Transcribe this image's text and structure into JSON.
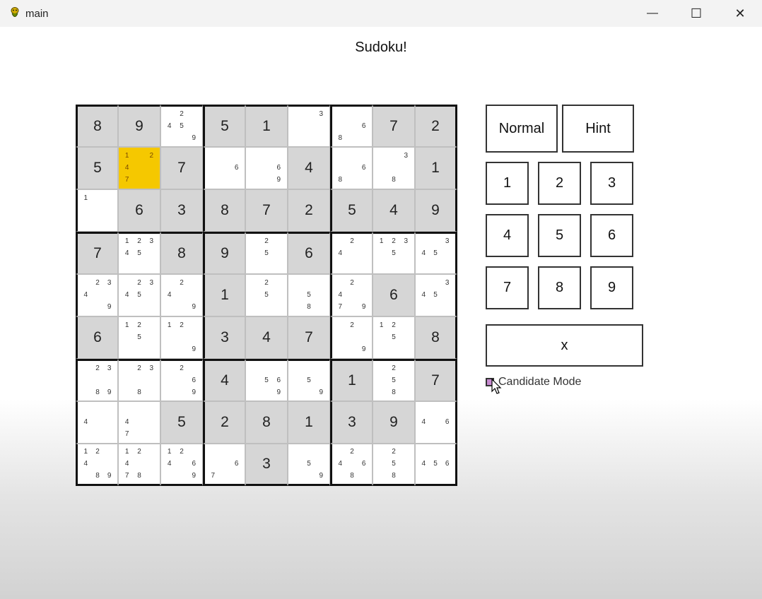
{
  "window": {
    "title": "main",
    "icon": "python-snake-icon",
    "controls": {
      "minimize": "—",
      "maximize": "☐",
      "close": "✕"
    }
  },
  "heading": "Sudoku!",
  "board": {
    "selected": [
      1,
      1
    ],
    "cells": [
      [
        {
          "v": "8"
        },
        {
          "v": "9"
        },
        {
          "c": [
            "",
            "2",
            "",
            "4",
            "5",
            "",
            "",
            "",
            "9"
          ]
        },
        {
          "v": "5"
        },
        {
          "v": "1"
        },
        {
          "c": [
            "",
            "",
            "3",
            "",
            "",
            "",
            "",
            "",
            ""
          ]
        },
        {
          "c": [
            "",
            "",
            "",
            "",
            "",
            "6",
            "8",
            "",
            ""
          ]
        },
        {
          "v": "7"
        },
        {
          "v": "2"
        }
      ],
      [
        {
          "v": "5"
        },
        {
          "c": [
            "1",
            "",
            "2",
            "4",
            "",
            "",
            "7",
            "",
            ""
          ]
        },
        {
          "v": "7"
        },
        {
          "c": [
            "",
            "",
            "",
            "",
            "",
            "6",
            "",
            "",
            ""
          ]
        },
        {
          "c": [
            "",
            "",
            "",
            "",
            "",
            "6",
            "",
            "",
            "9"
          ]
        },
        {
          "v": "4"
        },
        {
          "c": [
            "",
            "",
            "",
            "",
            "",
            "6",
            "8",
            "",
            ""
          ]
        },
        {
          "c": [
            "",
            "",
            "3",
            "",
            "",
            "",
            "",
            "8",
            ""
          ]
        },
        {
          "v": "1"
        }
      ],
      [
        {
          "c": [
            "1",
            "",
            "",
            "",
            "",
            "",
            "",
            "",
            ""
          ]
        },
        {
          "v": "6"
        },
        {
          "v": "3"
        },
        {
          "v": "8"
        },
        {
          "v": "7"
        },
        {
          "v": "2"
        },
        {
          "v": "5"
        },
        {
          "v": "4"
        },
        {
          "v": "9"
        }
      ],
      [
        {
          "v": "7"
        },
        {
          "c": [
            "1",
            "2",
            "3",
            "4",
            "5",
            "",
            "",
            "",
            ""
          ]
        },
        {
          "v": "8"
        },
        {
          "v": "9"
        },
        {
          "c": [
            "",
            "2",
            "",
            "",
            "5",
            "",
            "",
            "",
            ""
          ]
        },
        {
          "v": "6"
        },
        {
          "c": [
            "",
            "2",
            "",
            "4",
            "",
            "",
            "",
            "",
            ""
          ]
        },
        {
          "c": [
            "1",
            "2",
            "3",
            "",
            "5",
            "",
            "",
            "",
            ""
          ]
        },
        {
          "c": [
            "",
            "",
            "3",
            "4",
            "5",
            "",
            "",
            "",
            ""
          ]
        }
      ],
      [
        {
          "c": [
            "",
            "2",
            "3",
            "4",
            "",
            "",
            "",
            "",
            "9"
          ]
        },
        {
          "c": [
            "",
            "2",
            "3",
            "4",
            "5",
            "",
            "",
            "",
            ""
          ]
        },
        {
          "c": [
            "",
            "2",
            "",
            "4",
            "",
            "",
            "",
            "",
            "9"
          ]
        },
        {
          "v": "1"
        },
        {
          "c": [
            "",
            "2",
            "",
            "",
            "5",
            "",
            "",
            "",
            ""
          ]
        },
        {
          "c": [
            "",
            "",
            "",
            "",
            "5",
            "",
            "",
            "8",
            ""
          ]
        },
        {
          "c": [
            "",
            "2",
            "",
            "4",
            "",
            "",
            "7",
            "",
            "9"
          ]
        },
        {
          "v": "6"
        },
        {
          "c": [
            "",
            "",
            "3",
            "4",
            "5",
            "",
            "",
            "",
            ""
          ]
        }
      ],
      [
        {
          "v": "6"
        },
        {
          "c": [
            "1",
            "2",
            "",
            "",
            "5",
            "",
            "",
            "",
            ""
          ]
        },
        {
          "c": [
            "1",
            "2",
            "",
            "",
            "",
            "",
            "",
            "",
            "9"
          ]
        },
        {
          "v": "3"
        },
        {
          "v": "4"
        },
        {
          "v": "7"
        },
        {
          "c": [
            "",
            "2",
            "",
            "",
            "",
            "",
            "",
            "",
            "9"
          ]
        },
        {
          "c": [
            "1",
            "2",
            "",
            "",
            "5",
            "",
            "",
            "",
            ""
          ]
        },
        {
          "v": "8"
        }
      ],
      [
        {
          "c": [
            "",
            "2",
            "3",
            "",
            "",
            "",
            "",
            "8",
            "9"
          ]
        },
        {
          "c": [
            "",
            "2",
            "3",
            "",
            "",
            "",
            "",
            "8",
            ""
          ]
        },
        {
          "c": [
            "",
            "2",
            "",
            "",
            "",
            "6",
            "",
            "",
            "9"
          ]
        },
        {
          "v": "4"
        },
        {
          "c": [
            "",
            "",
            "",
            "",
            "5",
            "6",
            "",
            "",
            "9"
          ]
        },
        {
          "c": [
            "",
            "",
            "",
            "",
            "5",
            "",
            "",
            "",
            "9"
          ]
        },
        {
          "v": "1"
        },
        {
          "c": [
            "",
            "2",
            "",
            "",
            "5",
            "",
            "",
            "8",
            ""
          ]
        },
        {
          "v": "7"
        }
      ],
      [
        {
          "c": [
            "",
            "",
            "",
            "4",
            "",
            "",
            "",
            "",
            ""
          ]
        },
        {
          "c": [
            "",
            "",
            "",
            "4",
            "",
            "",
            "7",
            "",
            ""
          ]
        },
        {
          "v": "5"
        },
        {
          "v": "2"
        },
        {
          "v": "8"
        },
        {
          "v": "1"
        },
        {
          "v": "3"
        },
        {
          "v": "9"
        },
        {
          "c": [
            "",
            "",
            "",
            "4",
            "",
            "6",
            "",
            "",
            ""
          ]
        }
      ],
      [
        {
          "c": [
            "1",
            "2",
            "",
            "4",
            "",
            "",
            "",
            "8",
            "9"
          ]
        },
        {
          "c": [
            "1",
            "2",
            "",
            "4",
            "",
            "",
            "7",
            "8",
            ""
          ]
        },
        {
          "c": [
            "1",
            "2",
            "",
            "4",
            "",
            "6",
            "",
            "",
            "9"
          ]
        },
        {
          "c": [
            "",
            "",
            "",
            "",
            "",
            "6",
            "7",
            "",
            ""
          ]
        },
        {
          "v": "3"
        },
        {
          "c": [
            "",
            "",
            "",
            "",
            "5",
            "",
            "",
            "",
            "9"
          ]
        },
        {
          "c": [
            "",
            "2",
            "",
            "4",
            "",
            "6",
            "",
            "8",
            ""
          ]
        },
        {
          "c": [
            "",
            "2",
            "",
            "",
            "5",
            "",
            "",
            "8",
            ""
          ]
        },
        {
          "c": [
            "",
            "",
            "",
            "4",
            "5",
            "6",
            "",
            "",
            ""
          ]
        }
      ]
    ]
  },
  "controls": {
    "normal": "Normal",
    "hint": "Hint",
    "digits": [
      "1",
      "2",
      "3",
      "4",
      "5",
      "6",
      "7",
      "8",
      "9"
    ],
    "clear": "x",
    "candidate_mode_label": "Candidate Mode"
  },
  "colors": {
    "selected": "#f5c800",
    "given": "#d6d6d6",
    "empty": "#ffffff",
    "checkbox": "#c78ad0"
  }
}
